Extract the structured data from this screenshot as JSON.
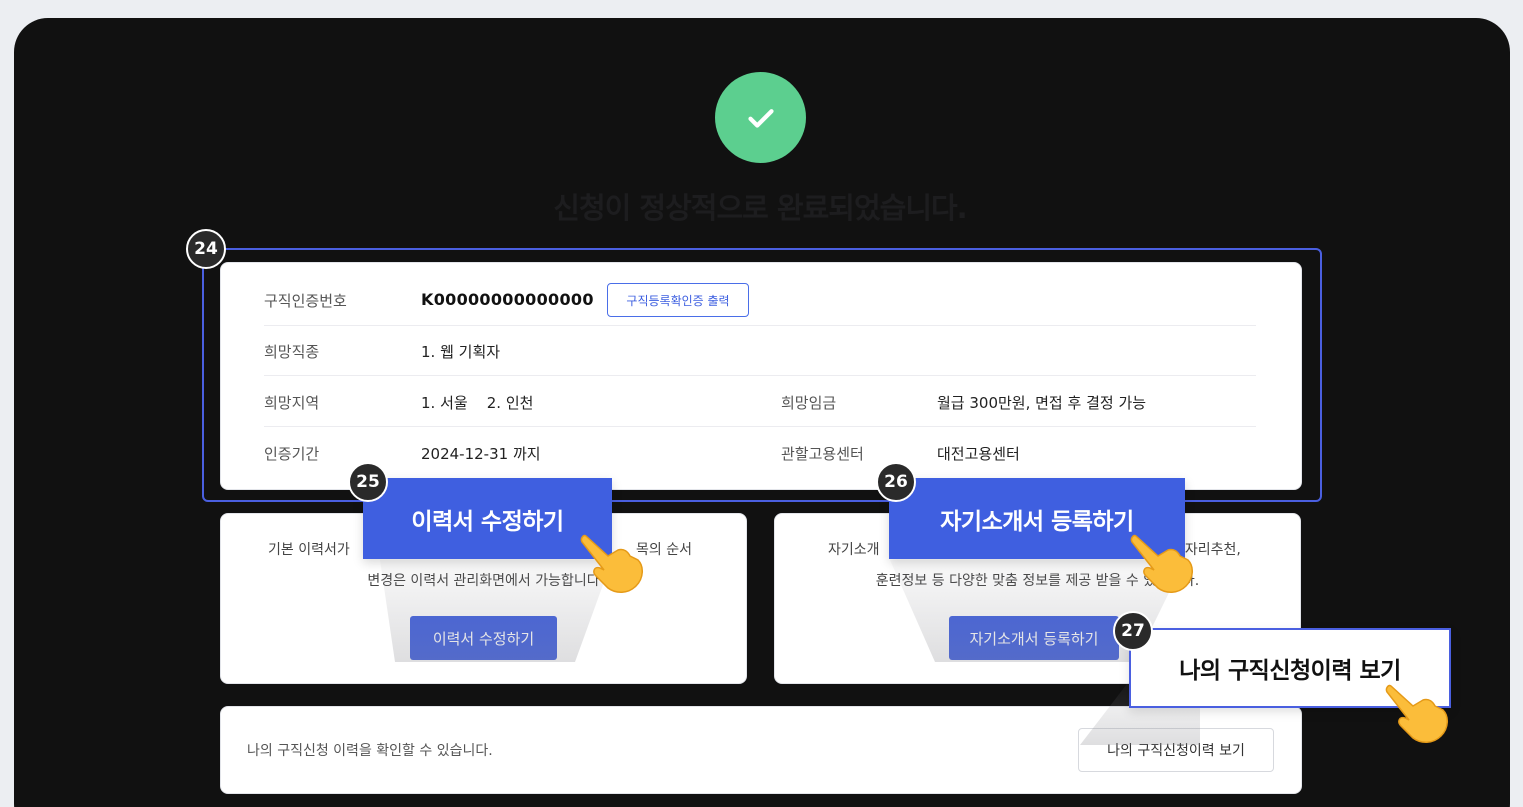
{
  "page": {
    "title": "신청이 정상적으로 완료되었습니다.",
    "colors": {
      "accent": "#3f5fe0",
      "success": "#5ccf8f",
      "badge": "#2a2a2a"
    }
  },
  "icons": {
    "success": "check-circle-icon",
    "pointer": "pointing-hand-icon"
  },
  "info": {
    "cert_label": "구직인증번호",
    "cert_value": "K00000000000000",
    "cert_print_label": "구직등록확인증 출력",
    "job_label": "희망직종",
    "job_value": "1. 웹 기획자",
    "region_label": "희망지역",
    "region_value": "1. 서울    2. 인천",
    "wage_label": "희망임금",
    "wage_value": "월급 300만원, 면접 후 결정 가능",
    "period_label": "인증기간",
    "period_value": "2024-12-31 까지",
    "center_label": "관할고용센터",
    "center_value": "대전고용센터"
  },
  "resume_card": {
    "text_line1": "기본 이력서가",
    "text_line1_end": "목의 순서",
    "text_line2": "변경은 이력서 관리화면에서 가능합니다",
    "button": "이력서 수정하기"
  },
  "intro_card": {
    "text_line1": "자기소개",
    "text_line1_end": "일자리추천,",
    "text_line2": "훈련정보 등 다양한 맞춤 정보를 제공 받을 수 있습니다.",
    "button": "자기소개서 등록하기"
  },
  "history": {
    "text": "나의 구직신청 이력을 확인할 수 있습니다.",
    "button": "나의 구직신청이력 보기"
  },
  "annotations": {
    "badge_24": "24",
    "badge_25": "25",
    "badge_26": "26",
    "badge_27": "27",
    "callout_25": "이력서 수정하기",
    "callout_26": "자기소개서 등록하기",
    "callout_27": "나의 구직신청이력 보기"
  }
}
